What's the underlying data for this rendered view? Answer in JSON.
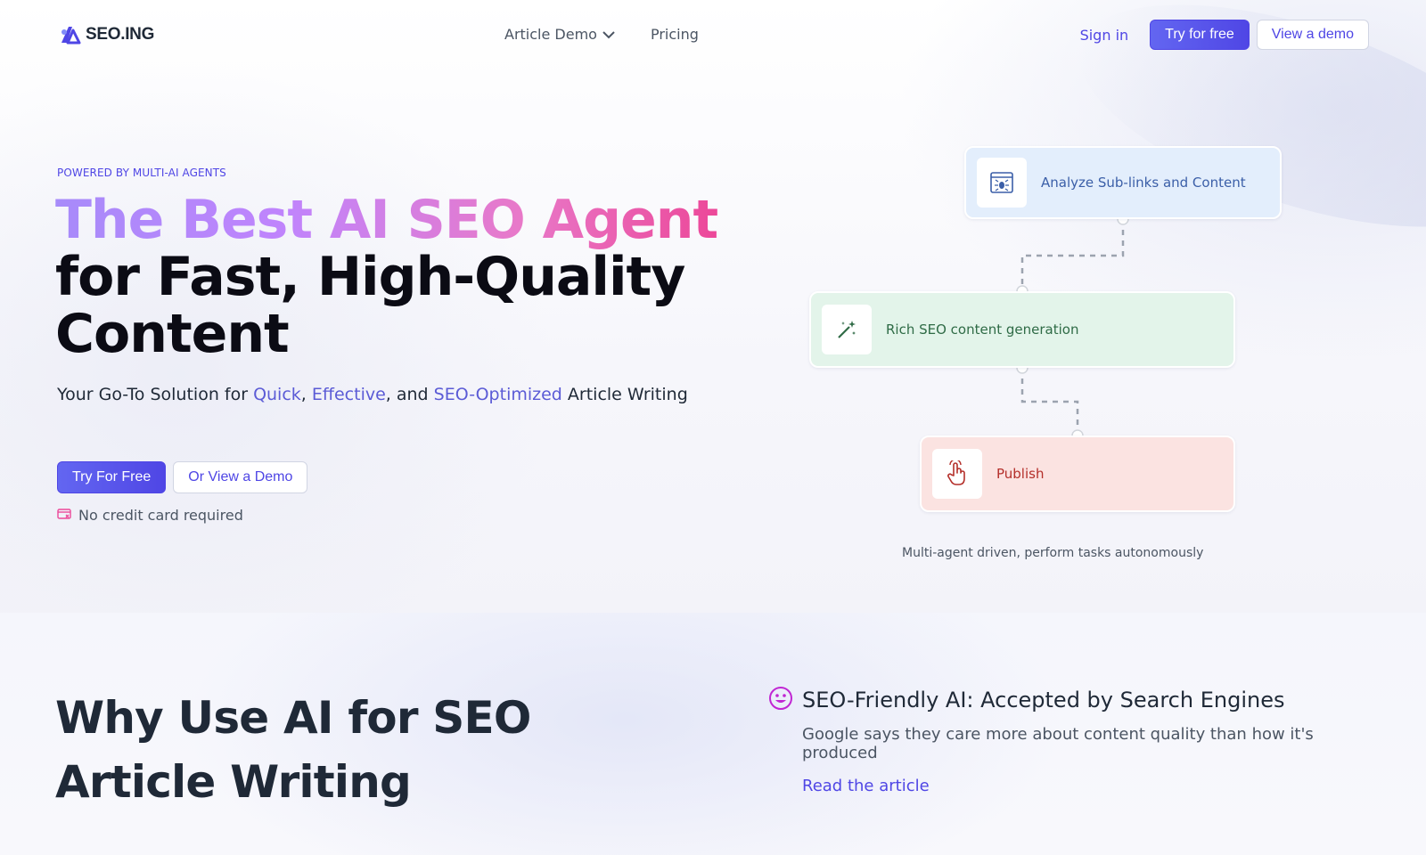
{
  "nav": {
    "logo_text": "SEO.ING",
    "links": [
      {
        "label": "Article Demo",
        "has_dropdown": true
      },
      {
        "label": "Pricing"
      }
    ],
    "signin": "Sign in",
    "try_free": "Try for free",
    "view_demo": "View a demo"
  },
  "hero": {
    "eyebrow": "POWERED BY MULTI-AI AGENTS",
    "headline_gradient": "The Best AI SEO Agent",
    "headline_rest": "for Fast, High-Quality Content",
    "subhead": {
      "prefix": "Your Go-To Solution for ",
      "quick": "Quick",
      "sep1": ", ",
      "effective": "Effective",
      "sep2": ", and ",
      "seo": "SEO-Optimized",
      "suffix": " Article Writing"
    },
    "cta_primary": "Try For Free",
    "cta_secondary": "Or View a Demo",
    "no_cc": "No credit card required"
  },
  "flow": {
    "steps": [
      {
        "label": "Analyze Sub-links and Content",
        "icon": "spider-browser-icon"
      },
      {
        "label": "Rich SEO content generation",
        "icon": "magic-wand-icon"
      },
      {
        "label": "Publish",
        "icon": "pointer-hand-icon"
      }
    ],
    "caption": "Multi-agent driven, perform tasks autonomously"
  },
  "why": {
    "title": "Why Use AI for SEO Article Writing",
    "feature": {
      "title": "SEO-Friendly AI: Accepted by Search Engines",
      "desc": "Google says they care more about content quality than how it's produced",
      "link": "Read the article",
      "icon": "smiley-icon"
    }
  },
  "colors": {
    "accent": "#4f46e5",
    "card_blue": "#e3eefc",
    "card_green": "#e3f4ea",
    "card_red": "#fbe3e1",
    "gradient_start": "#a78bfa",
    "gradient_end": "#ec4899"
  }
}
